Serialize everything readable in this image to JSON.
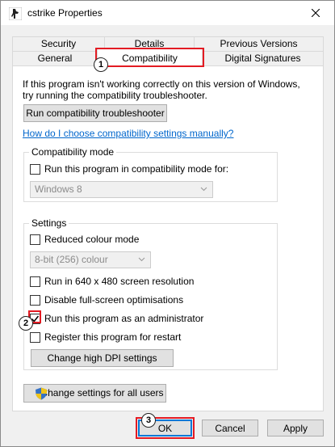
{
  "window": {
    "title": "cstrike Properties"
  },
  "tabs": {
    "row1": [
      "Security",
      "Details",
      "Previous Versions"
    ],
    "row2": [
      "General",
      "Compatibility",
      "Digital Signatures"
    ]
  },
  "intro_text_1": "If this program isn't working correctly on this version of Windows,",
  "intro_text_2": "try running the compatibility troubleshooter.",
  "troubleshooter_button": "Run compatibility troubleshooter",
  "manual_link": "How do I choose compatibility settings manually?",
  "compat_mode": {
    "title": "Compatibility mode",
    "checkbox": "Run this program in compatibility mode for:",
    "select_value": "Windows 8"
  },
  "settings": {
    "title": "Settings",
    "reduced_colour": "Reduced colour mode",
    "colour_select_value": "8-bit (256) colour",
    "run_640": "Run in 640 x 480 screen resolution",
    "disable_fullscreen": "Disable full-screen optimisations",
    "run_admin": "Run this program as an administrator",
    "register_restart": "Register this program for restart",
    "dpi_button": "Change high DPI settings"
  },
  "all_users_button": "Change settings for all users",
  "footer": {
    "ok": "OK",
    "cancel": "Cancel",
    "apply": "Apply"
  },
  "markers": [
    "1",
    "2",
    "3"
  ],
  "colors": {
    "highlight": "#e31b23",
    "link": "#0066cc"
  }
}
